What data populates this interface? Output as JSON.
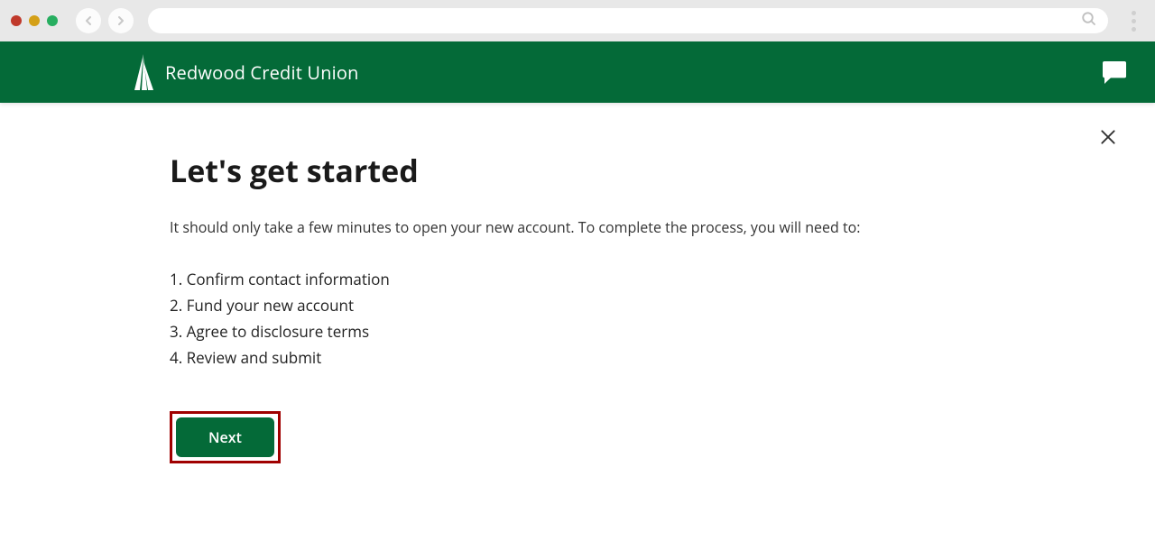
{
  "brand": {
    "name": "Redwood Credit Union"
  },
  "page": {
    "title": "Let's get started",
    "intro": "It should only take a few minutes to open your new account. To complete the process, you will need to:",
    "steps": [
      "Confirm contact information",
      "Fund your new account",
      "Agree to disclosure terms",
      "Review and submit"
    ],
    "next_label": "Next"
  },
  "colors": {
    "primary": "#046a38",
    "highlight_border": "#a00000"
  }
}
